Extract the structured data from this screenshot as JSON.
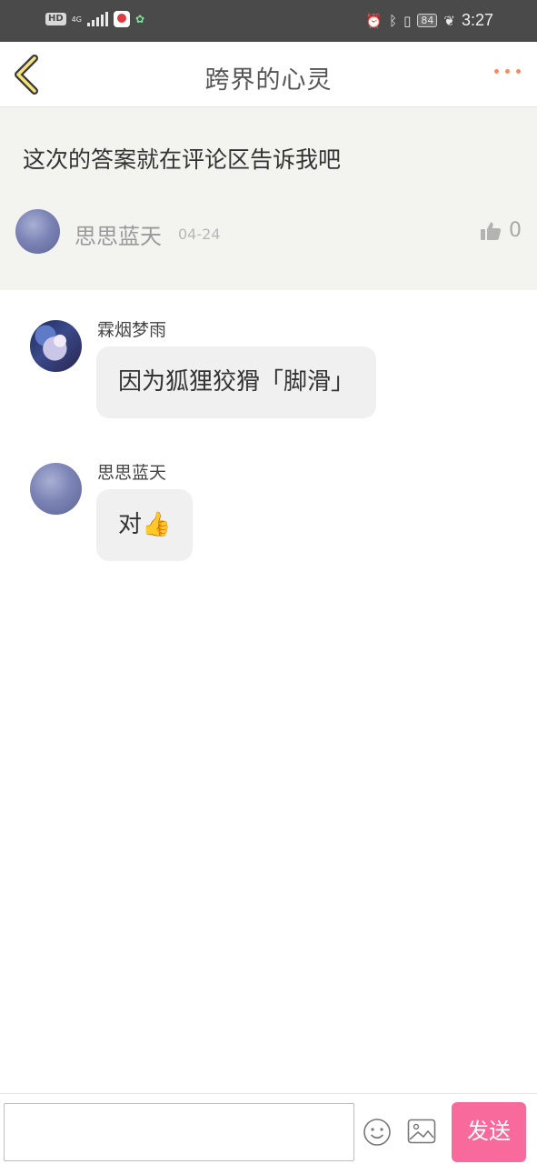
{
  "status_bar": {
    "hd": "HD",
    "network": "4G",
    "battery": "84",
    "time": "3:27",
    "icons": [
      "alarm-icon",
      "bluetooth-icon",
      "vibrate-icon",
      "leaf-icon"
    ]
  },
  "header": {
    "title": "跨界的心灵",
    "back_icon": "chevron-left-icon",
    "more_icon": "more-dots-icon",
    "accent": "#f08c6a"
  },
  "post": {
    "text": "这次的答案就在评论区告诉我吧",
    "author": "思思蓝天",
    "date": "04-24",
    "likes": "0",
    "like_icon": "thumbs-up-icon"
  },
  "comments": [
    {
      "author": "霖烟梦雨",
      "text": "因为狐狸狡猾「脚滑」"
    },
    {
      "author": "思思蓝天",
      "text": "对👍"
    }
  ],
  "input_bar": {
    "placeholder": "",
    "send_label": "发送",
    "send_color": "#f86a9b",
    "emoji_icon": "smiley-icon",
    "image_icon": "image-icon"
  }
}
